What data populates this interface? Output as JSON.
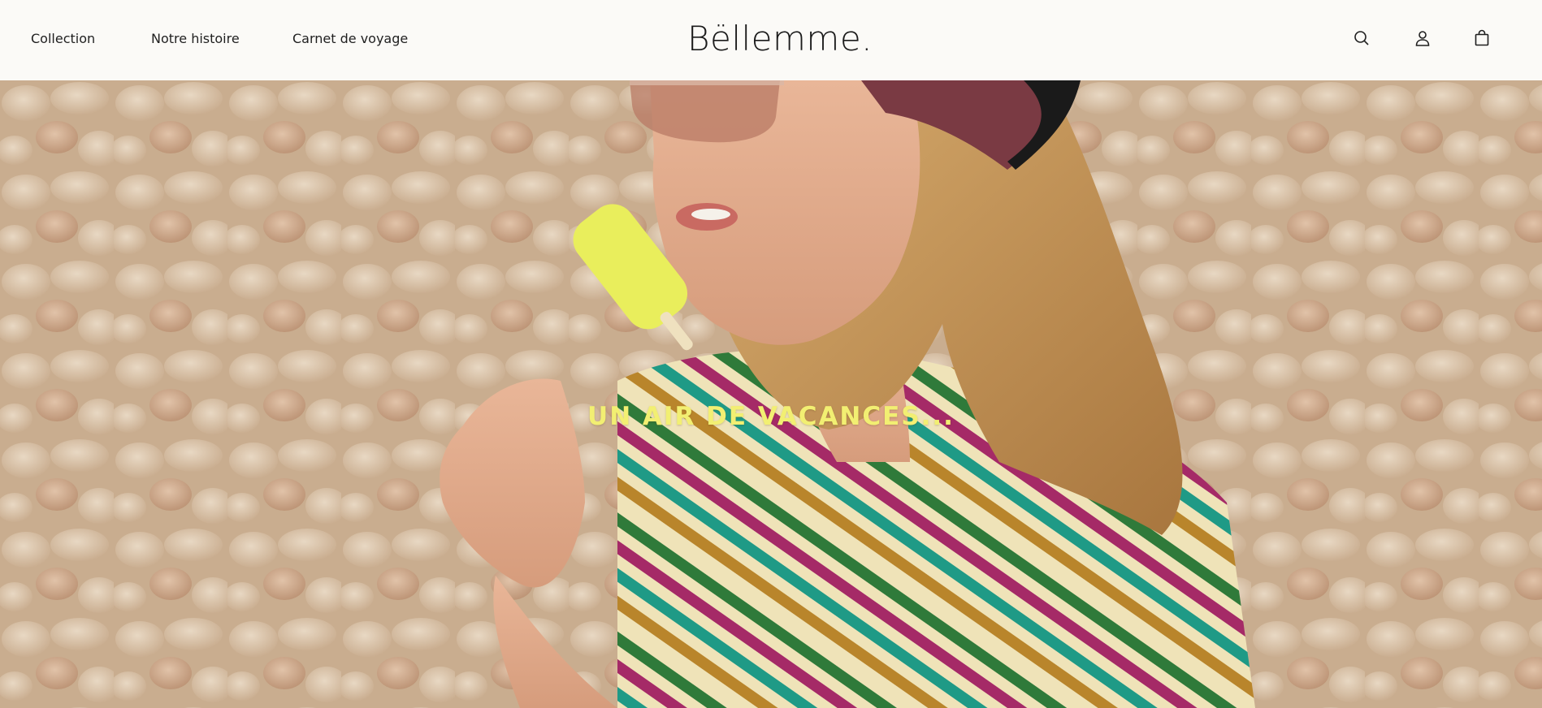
{
  "nav": {
    "links": [
      {
        "label": "Collection"
      },
      {
        "label": "Notre histoire"
      },
      {
        "label": "Carnet de voyage"
      }
    ]
  },
  "brand": {
    "name": "Bëllemme."
  },
  "header_icons": [
    {
      "icon": "search-icon"
    },
    {
      "icon": "user-icon"
    },
    {
      "icon": "shopping-bag-icon"
    }
  ],
  "hero": {
    "headline": "UN AIR DE VACANCES...",
    "headline_color": "#f2ef72",
    "image_subject": "photo"
  },
  "colors": {
    "header_bg": "#fbfaf7",
    "text": "#1f1f1f"
  }
}
